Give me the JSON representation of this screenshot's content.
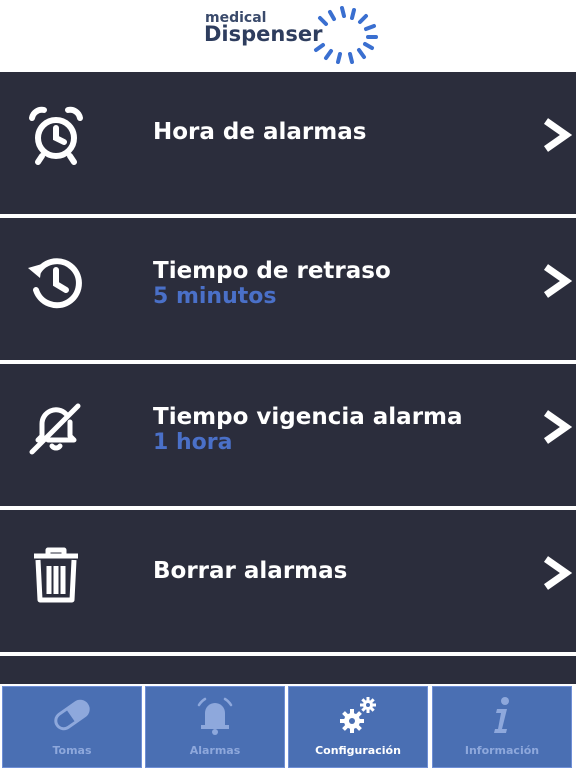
{
  "header": {
    "logo_line1": "medical",
    "logo_line2": "Dispenser"
  },
  "menu": {
    "items": [
      {
        "icon": "alarm-clock-icon",
        "title": "Hora de alarmas",
        "subtitle": ""
      },
      {
        "icon": "history-clock-icon",
        "title": "Tiempo de retraso",
        "subtitle": "5 minutos"
      },
      {
        "icon": "bell-off-icon",
        "title": "Tiempo vigencia alarma",
        "subtitle": "1 hora"
      },
      {
        "icon": "trash-icon",
        "title": "Borrar alarmas",
        "subtitle": ""
      }
    ]
  },
  "tabs": {
    "items": [
      {
        "icon": "pill-icon",
        "label": "Tomas",
        "active": false
      },
      {
        "icon": "alarm-bell-icon",
        "label": "Alarmas",
        "active": false
      },
      {
        "icon": "gears-icon",
        "label": "Configuración",
        "active": true
      },
      {
        "icon": "info-icon",
        "label": "Información",
        "active": false
      }
    ]
  },
  "colors": {
    "menu_background": "#2b2d3c",
    "subtitle_blue": "#4a70c8",
    "tab_background": "#4a6fb3",
    "tab_label_inactive": "#8ea8dc",
    "logo_ray_blue": "#3a6fd0"
  }
}
